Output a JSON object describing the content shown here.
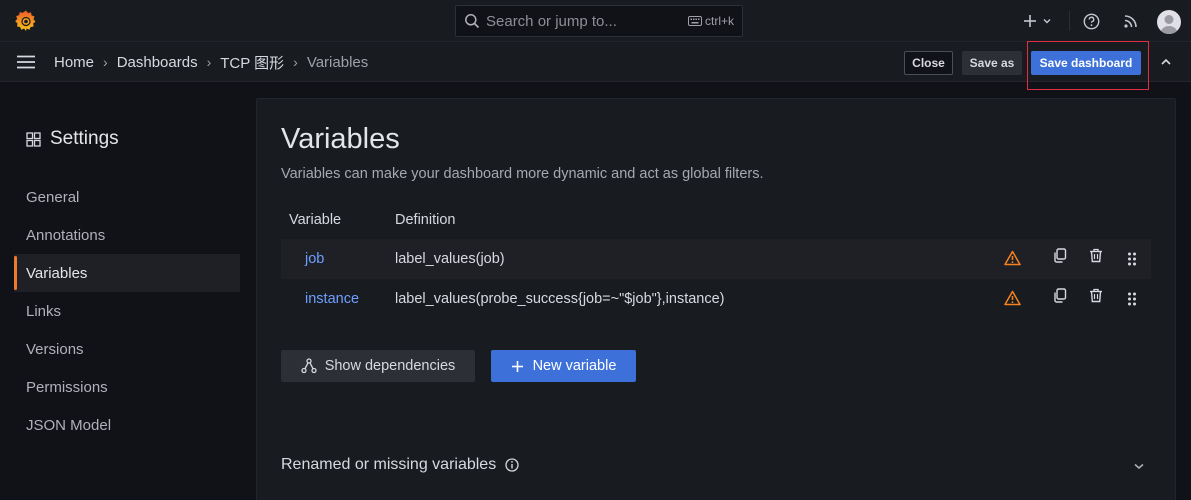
{
  "colors": {
    "background": "#111217",
    "panel": "#181b1f",
    "primary": "#3d71d9",
    "link": "#6e9fff",
    "active_indicator": "#ef7a2e",
    "warning": "#f5821f",
    "highlight_border": "#e02f44"
  },
  "topbar": {
    "logo_icon": "grafana-logo-icon",
    "search": {
      "placeholder": "Search or jump to...",
      "shortcut": "ctrl+k"
    },
    "icons": [
      "plus-icon",
      "chevron-down-icon",
      "help-icon",
      "rss-icon",
      "avatar"
    ]
  },
  "breadcrumbs": [
    "Home",
    "Dashboards",
    "TCP 图形",
    "Variables"
  ],
  "actions": {
    "close": "Close",
    "save_as": "Save as",
    "save_dashboard": "Save dashboard"
  },
  "sidebar": {
    "title": "Settings",
    "items": [
      {
        "label": "General",
        "active": false
      },
      {
        "label": "Annotations",
        "active": false
      },
      {
        "label": "Variables",
        "active": true
      },
      {
        "label": "Links",
        "active": false
      },
      {
        "label": "Versions",
        "active": false
      },
      {
        "label": "Permissions",
        "active": false
      },
      {
        "label": "JSON Model",
        "active": false
      }
    ]
  },
  "main": {
    "title": "Variables",
    "description": "Variables can make your dashboard more dynamic and act as global filters.",
    "table": {
      "headers": [
        "Variable",
        "Definition"
      ],
      "rows": [
        {
          "name": "job",
          "definition": "label_values(job)"
        },
        {
          "name": "instance",
          "definition": "label_values(probe_success{job=~\"$job\"},instance)"
        }
      ]
    },
    "buttons": {
      "show_dependencies": "Show dependencies",
      "new_variable": "New variable"
    },
    "renamed_section": "Renamed or missing variables"
  }
}
